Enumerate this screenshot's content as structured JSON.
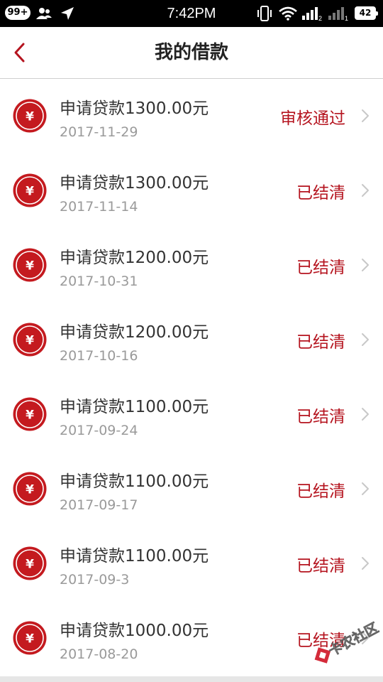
{
  "status_bar": {
    "badge": "99+",
    "time": "7:42PM",
    "battery": "42",
    "icons": [
      "notification-badge",
      "contacts-icon",
      "location-arrow-icon",
      "vibrate-icon",
      "wifi-icon",
      "signal-icon",
      "signal-icon-2",
      "battery-icon"
    ]
  },
  "nav": {
    "title": "我的借款",
    "back_icon": "chevron-left-icon"
  },
  "colors": {
    "accent": "#b5141f",
    "date": "#9a9a9a",
    "title": "#333333"
  },
  "loans": [
    {
      "title": "申请贷款1300.00元",
      "date": "2017-11-29",
      "status": "审核通过"
    },
    {
      "title": "申请贷款1300.00元",
      "date": "2017-11-14",
      "status": "已结清"
    },
    {
      "title": "申请贷款1200.00元",
      "date": "2017-10-31",
      "status": "已结清"
    },
    {
      "title": "申请贷款1200.00元",
      "date": "2017-10-16",
      "status": "已结清"
    },
    {
      "title": "申请贷款1100.00元",
      "date": "2017-09-24",
      "status": "已结清"
    },
    {
      "title": "申请贷款1100.00元",
      "date": "2017-09-17",
      "status": "已结清"
    },
    {
      "title": "申请贷款1100.00元",
      "date": "2017-09-3",
      "status": "已结清"
    },
    {
      "title": "申请贷款1000.00元",
      "date": "2017-08-20",
      "status": "已结清"
    }
  ],
  "coin_symbol": "¥",
  "watermark": "卡农社区"
}
